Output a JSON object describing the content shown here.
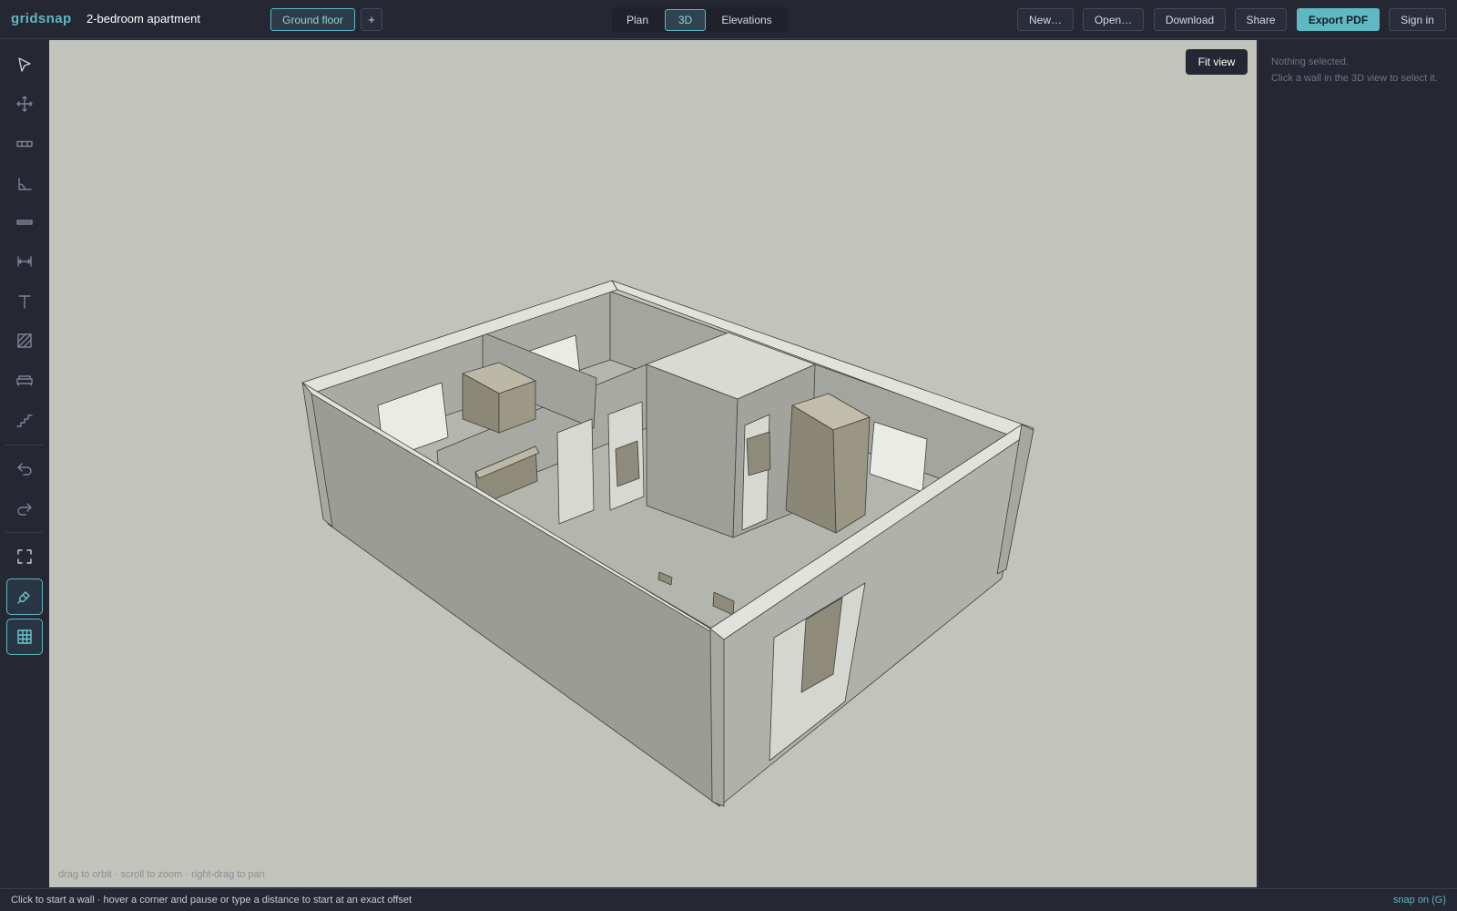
{
  "app": {
    "brand": "gridsnap",
    "project_name": "2-bedroom apartment"
  },
  "floor": {
    "current": "Ground floor",
    "add_label": "+"
  },
  "view_tabs": [
    {
      "label": "Plan",
      "active": false
    },
    {
      "label": "3D",
      "active": true
    },
    {
      "label": "Elevations",
      "active": false
    }
  ],
  "actions": {
    "new": "New…",
    "open": "Open…",
    "download": "Download",
    "share": "Share",
    "export_pdf": "Export PDF",
    "sign_in": "Sign in"
  },
  "toolbar": [
    {
      "name": "select-tool",
      "icon": "cursor-icon"
    },
    {
      "name": "move-tool",
      "icon": "move-icon"
    },
    {
      "name": "wall-tool",
      "icon": "wall-icon"
    },
    {
      "name": "room-tool",
      "icon": "room-icon"
    },
    {
      "name": "opening-tool",
      "icon": "opening-icon"
    },
    {
      "name": "dimension-tool",
      "icon": "dimension-icon"
    },
    {
      "name": "text-tool",
      "icon": "text-icon"
    },
    {
      "name": "hatch-tool",
      "icon": "hatch-icon"
    },
    {
      "name": "furniture-tool",
      "icon": "sofa-icon"
    },
    {
      "name": "stairs-tool",
      "icon": "stairs-icon"
    },
    {
      "name": "undo-button",
      "icon": "undo-icon"
    },
    {
      "name": "redo-button",
      "icon": "redo-icon"
    },
    {
      "name": "fullscreen-button",
      "icon": "fullscreen-icon"
    },
    {
      "name": "snap-toggle",
      "icon": "magnet-icon",
      "active": true
    },
    {
      "name": "grid-toggle",
      "icon": "grid-icon",
      "active": true
    }
  ],
  "viewport": {
    "fit_view_label": "Fit view",
    "hint": "drag to orbit · scroll to zoom · right-drag to pan"
  },
  "inspector": {
    "title": "Nothing selected.",
    "description": "Click a wall in the 3D view to select it."
  },
  "status": {
    "message": "Click to start a wall · hover a corner and pause or type a distance to start at an exact offset",
    "snap": "snap on (G)"
  },
  "colors": {
    "accent": "#5fb8c2",
    "chrome": "#252733",
    "viewport_bg": "#c2c3bb"
  }
}
